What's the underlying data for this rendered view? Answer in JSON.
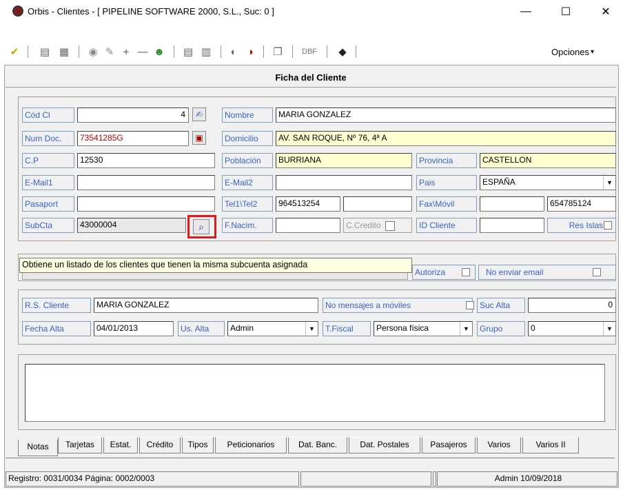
{
  "window": {
    "title": "Orbis - Clientes - [ PIPELINE SOFTWARE 2000, S.L.,  Suc: 0 ]",
    "minimize": "—",
    "maximize": "☐",
    "close": "✕"
  },
  "toolbar": {
    "options_label": "Opciones",
    "options_arrow": "▾"
  },
  "header": {
    "title": "Ficha del Cliente"
  },
  "form": {
    "cod_cl": {
      "label": "Cód Cl",
      "value": "4"
    },
    "num_doc": {
      "label": "Num Doc.",
      "value": "73541285G"
    },
    "cp": {
      "label": "C.P",
      "value": "12530"
    },
    "email1": {
      "label": "E-Mail1",
      "value": ""
    },
    "pasaport": {
      "label": "Pasaport",
      "value": ""
    },
    "subcta": {
      "label": "SubCta",
      "value": "43000004"
    },
    "nombre": {
      "label": "Nombre",
      "value": "MARIA GONZALEZ"
    },
    "domicilio": {
      "label": "Domicilio",
      "value": "AV. SAN ROQUE, Nº 76, 4ª A"
    },
    "poblacion": {
      "label": "Población",
      "value": "BURRIANA"
    },
    "provincia": {
      "label": "Provincia",
      "value": "CASTELLON"
    },
    "email2": {
      "label": "E-Mail2",
      "value": ""
    },
    "pais": {
      "label": "Pais",
      "value": "ESPAÑA"
    },
    "tel": {
      "label": "Tel1\\Tel2",
      "value1": "964513254",
      "value2": ""
    },
    "fax": {
      "label": "Fax\\Móvil",
      "value1": "",
      "value2": "654785124"
    },
    "fnacim": {
      "label": "F.Nacim.",
      "value": ""
    },
    "ccredito": {
      "label": "C.Credito"
    },
    "id_cliente": {
      "label": "ID Cliente",
      "value": ""
    },
    "res_islas": {
      "label": "Res Islas"
    }
  },
  "row2": {
    "autoriza": "Autoriza",
    "no_enviar_email": "No enviar email"
  },
  "tooltip": "Obtiene un listado de los clientes que tienen la misma subcuenta asignada",
  "rs": {
    "rs_cliente": {
      "label": "R.S. Cliente",
      "value": "MARIA GONZALEZ"
    },
    "no_mensajes": "No mensajes a móviles",
    "suc_alta": {
      "label": "Suc Alta",
      "value": "0"
    },
    "fecha_alta": {
      "label": "Fecha Alta",
      "value": "04/01/2013"
    },
    "us_alta": {
      "label": "Us. Alta",
      "value": "Admin"
    },
    "tfiscal": {
      "label": "T.Fiscal",
      "value": "Persona física"
    },
    "grupo": {
      "label": "Grupo",
      "value": "0"
    }
  },
  "tabs": [
    {
      "label": "Notas"
    },
    {
      "label": "Tarjetas"
    },
    {
      "label": "Estat."
    },
    {
      "label": "Crédito"
    },
    {
      "label": "Tipos"
    },
    {
      "label": "Peticionarios"
    },
    {
      "label": "Dat. Banc."
    },
    {
      "label": "Dat. Postales"
    },
    {
      "label": "Pasajeros"
    },
    {
      "label": "Varios"
    },
    {
      "label": "Varios II"
    }
  ],
  "statusbar": {
    "registro": "Registro: 0031/0034  Página: 0002/0003",
    "panel2": "",
    "panel3": "",
    "user_date": "Admin 10/09/2018"
  }
}
